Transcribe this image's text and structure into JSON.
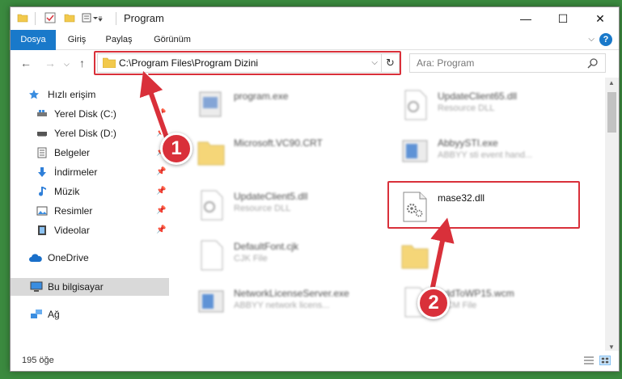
{
  "window": {
    "title": "Program",
    "controls": {
      "minimize": "—",
      "maximize": "☐",
      "close": "✕"
    }
  },
  "ribbon": {
    "tabs": [
      {
        "label": "Dosya",
        "active": true
      },
      {
        "label": "Giriş"
      },
      {
        "label": "Paylaş"
      },
      {
        "label": "Görünüm"
      }
    ],
    "help": "?"
  },
  "nav": {
    "address": "C:\\Program Files\\Program Dizini",
    "search_placeholder": "Ara: Program"
  },
  "sidebar": {
    "items": [
      {
        "label": "Hızlı erişim",
        "icon": "star-icon"
      },
      {
        "label": "Yerel Disk (C:)",
        "icon": "drive-icon",
        "pinned": true
      },
      {
        "label": "Yerel Disk (D:)",
        "icon": "drive-icon",
        "pinned": true
      },
      {
        "label": "Belgeler",
        "icon": "documents-icon",
        "pinned": true
      },
      {
        "label": "İndirmeler",
        "icon": "download-icon",
        "pinned": true
      },
      {
        "label": "Müzik",
        "icon": "music-icon",
        "pinned": true
      },
      {
        "label": "Resimler",
        "icon": "pictures-icon",
        "pinned": true
      },
      {
        "label": "Videolar",
        "icon": "videos-icon",
        "pinned": true
      },
      {
        "label": "OneDrive",
        "icon": "cloud-icon"
      },
      {
        "label": "Bu bilgisayar",
        "icon": "computer-icon",
        "selected": true
      },
      {
        "label": "Ağ",
        "icon": "network-icon"
      }
    ]
  },
  "files": {
    "left": [
      {
        "name": "program.exe",
        "sub": "",
        "icon": "exe-icon"
      },
      {
        "name": "Microsoft.VC90.CRT",
        "sub": "",
        "icon": "folder-icon"
      },
      {
        "name": "UpdateClient5.dll",
        "sub": "Resource DLL",
        "icon": "dll-icon"
      },
      {
        "name": "DefaultFont.cjk",
        "sub": "CJK File",
        "icon": "file-icon"
      },
      {
        "name": "NetworkLicenseServer.exe",
        "sub": "ABBYY network licens...",
        "icon": "exe-icon"
      }
    ],
    "right": [
      {
        "name": "UpdateClient65.dll",
        "sub": "Resource DLL",
        "icon": "dll-icon"
      },
      {
        "name": "AbbyySTI.exe",
        "sub": "ABBYY sti event hand...",
        "icon": "exe-icon"
      },
      {
        "name": "mase32.dll",
        "sub": "",
        "icon": "dll-gear-icon",
        "highlighted": true
      },
      {
        "name": "",
        "sub": "",
        "icon": "folder-icon"
      },
      {
        "name": "AddToWP15.wcm",
        "sub": "WCM File",
        "icon": "file-icon"
      }
    ]
  },
  "status": {
    "count": "195 öğe"
  },
  "callouts": {
    "one": "1",
    "two": "2"
  },
  "colors": {
    "accent": "#1979ca",
    "highlight": "#d9303a",
    "selection": "#cce8ff"
  }
}
